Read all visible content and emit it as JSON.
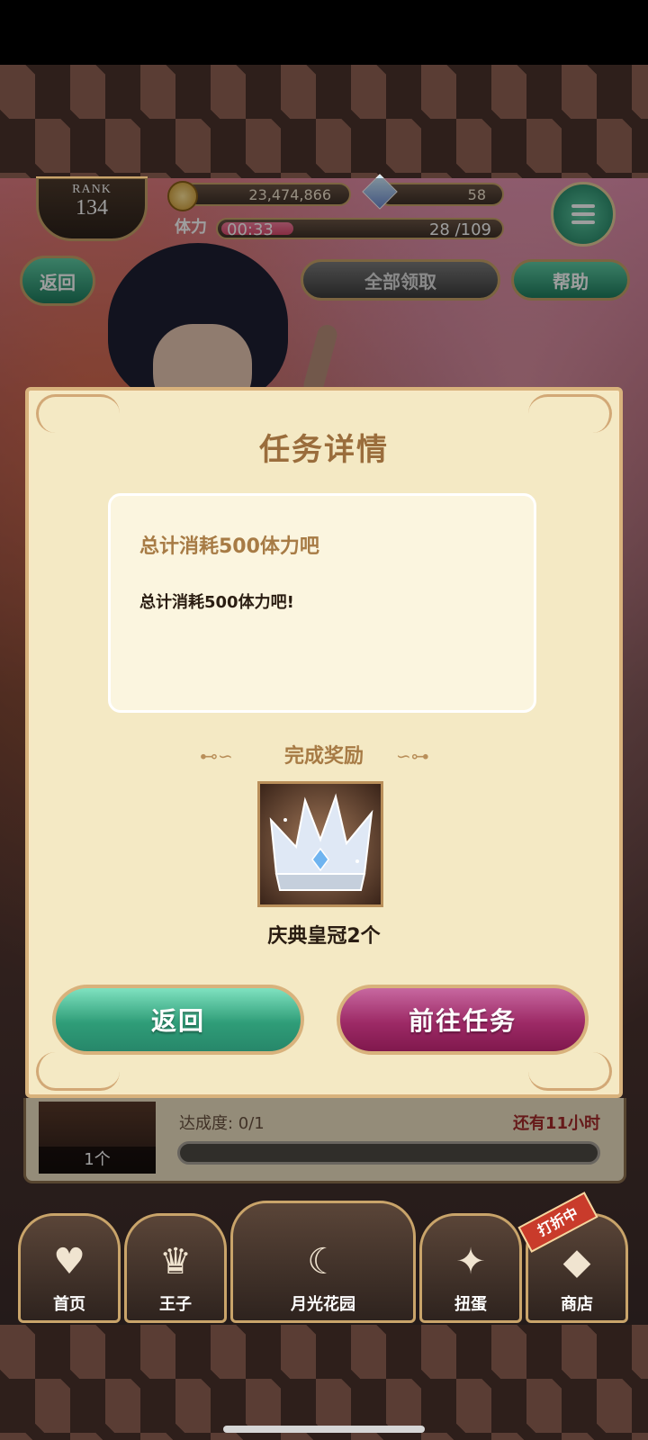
{
  "hud": {
    "rank_label": "RANK",
    "rank_value": "134",
    "coins": "23,474,866",
    "gems": "58",
    "stamina_label": "体力",
    "stamina_timer": "00:33",
    "stamina_count": "28 /109",
    "stamina_fraction": 0.26
  },
  "top_buttons": {
    "back": "返回",
    "claim_all": "全部领取",
    "help": "帮助"
  },
  "modal": {
    "title": "任务详情",
    "task_name": "总计消耗500体力吧",
    "task_desc": "总计消耗500体力吧!",
    "reward_title": "完成奖励",
    "reward_name": "庆典皇冠2个",
    "reward_icon": "crown-icon",
    "back_button": "返回",
    "go_button": "前往任务"
  },
  "background_task": {
    "count": "1个",
    "progress": "达成度: 0/1",
    "remaining": "还有11小时"
  },
  "nav": {
    "home": "首页",
    "prince": "王子",
    "garden": "月光花园",
    "gacha": "扭蛋",
    "shop": "商店",
    "sale_badge": "打折中"
  },
  "colors": {
    "modal_bg": "#f4e9c4",
    "gold": "#c9a46a",
    "green_button": "#2f9d78",
    "purple_button": "#9d2a66",
    "remaining_red": "#a52a2a"
  }
}
